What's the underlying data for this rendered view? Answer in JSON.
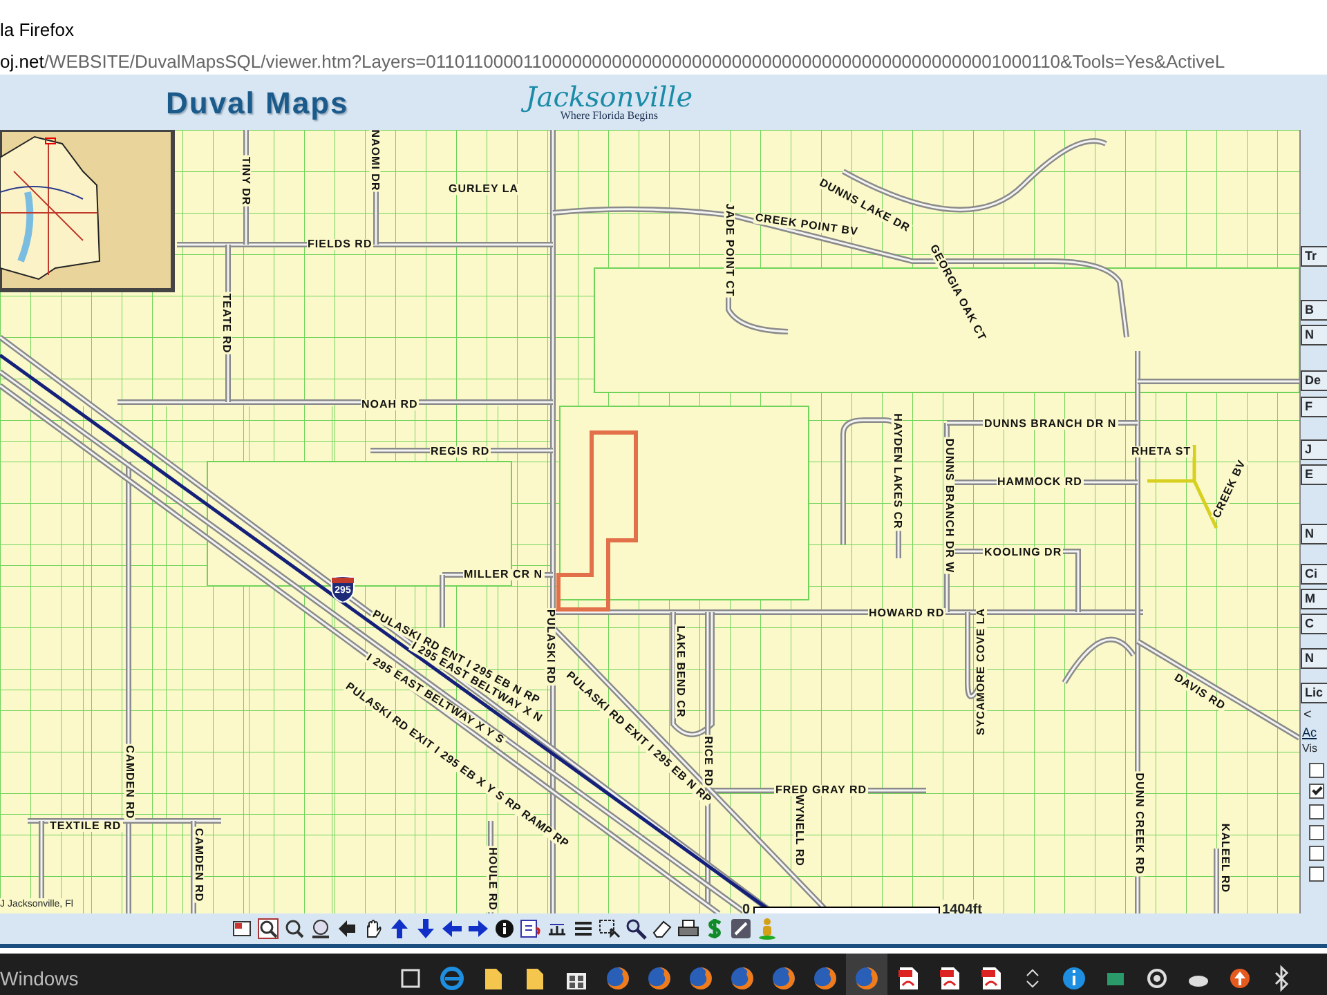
{
  "window": {
    "title": "la Firefox"
  },
  "address_bar": {
    "url": "**oj.net**/WEBSITE/DuvalMapsSQL/viewer.htm?Layers=0110110000110000000000000000000000000000000000000000000001000110&Tools=Yes&ActiveL"
  },
  "header": {
    "title": "Duval Maps",
    "logo": {
      "name": "Jacksonville",
      "tagline": "Where Florida Begins"
    }
  },
  "map": {
    "street_labels": [
      "TINY DR",
      "NAOMI DR",
      "GURLEY LA",
      "FIELDS RD",
      "TEATE RD",
      "NOAH RD",
      "REGIS RD",
      "DUNNS LAKE DR",
      "JADE POINT CT",
      "CREEK POINT BV",
      "GEORGIA OAK CT",
      "DUNNS BRANCH DR N",
      "RHETA ST",
      "CREEK BV",
      "HAMMOCK RD",
      "HAYDEN LAKES CR",
      "DUNNS BRANCH DR W",
      "KOOLING DR",
      "MILLER CR N",
      "HOWARD RD",
      "PULASKI RD",
      "LAKE BEND CR",
      "RICE RD",
      "SYCAMORE COVE LA",
      "DAVIS RD",
      "CAMDEN RD",
      "PULASKI RD ENT I 295 EB N RP",
      "I 295 EAST BELTWAY X N",
      "I 295 EAST BELTWAY X Y S",
      "PULASKI RD EXIT I 295 EB X Y S RP RAMP RP",
      "PULASKI RD EXIT I 295 EB N RP",
      "FRED GRAY RD",
      "WYNELL RD",
      "TEXTILE RD",
      "CAMDEN RD",
      "HOULE RD",
      "DUNN CREEK RD",
      "KALEEL RD"
    ],
    "highway_shield": "295",
    "scale_bar": {
      "start": "0",
      "end": "1404ft"
    },
    "copyright": "J Jacksonville, Fl"
  },
  "side_panel": {
    "items": [
      {
        "kind": "label",
        "text": "Tr"
      },
      {
        "kind": "label",
        "text": "B"
      },
      {
        "kind": "label",
        "text": "N"
      },
      {
        "kind": "label",
        "text": "De"
      },
      {
        "kind": "label",
        "text": "F"
      },
      {
        "kind": "label",
        "text": "J"
      },
      {
        "kind": "label",
        "text": "E"
      },
      {
        "kind": "label",
        "text": "N"
      },
      {
        "kind": "label",
        "text": "Ci"
      },
      {
        "kind": "label",
        "text": "M"
      },
      {
        "kind": "label",
        "text": "C"
      },
      {
        "kind": "label",
        "text": "N"
      },
      {
        "kind": "label",
        "text": "Lic"
      },
      {
        "kind": "arrow",
        "text": "<"
      },
      {
        "kind": "link",
        "text": "Ac"
      },
      {
        "kind": "heading",
        "text": "Vis"
      }
    ],
    "layer_checkboxes": [
      {
        "checked": false
      },
      {
        "checked": true
      },
      {
        "checked": false
      },
      {
        "checked": false
      },
      {
        "checked": false
      },
      {
        "checked": false
      }
    ]
  },
  "taskbar": {
    "search": "Windows"
  }
}
